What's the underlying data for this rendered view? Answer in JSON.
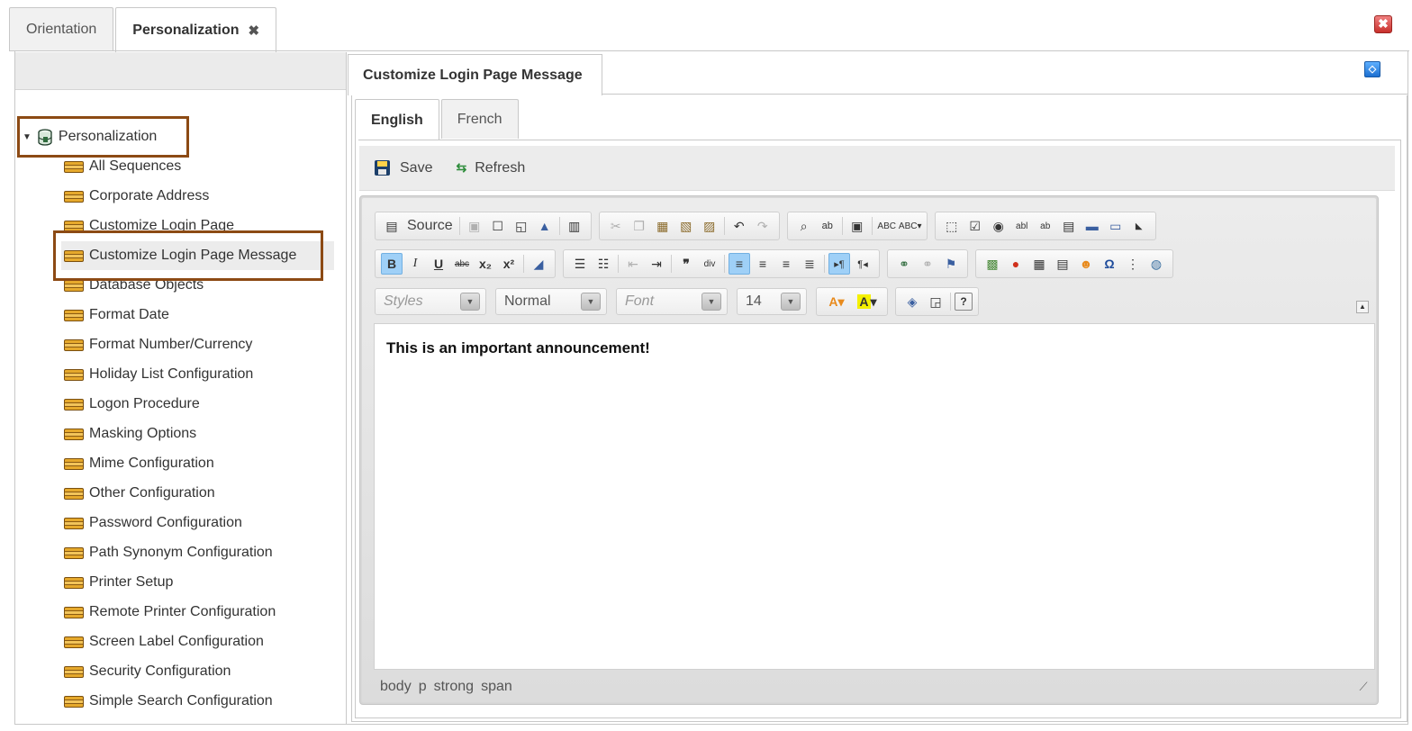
{
  "top_tabs": [
    {
      "label": "Orientation"
    },
    {
      "label": "Personalization",
      "close": "✖"
    }
  ],
  "window_close": "✖",
  "tree": {
    "root": "Personalization",
    "items": [
      "All Sequences",
      "Corporate Address",
      "Customize Login Page",
      "Customize Login Page Message",
      "Database Objects",
      "Format Date",
      "Format Number/Currency",
      "Holiday List Configuration",
      "Logon Procedure",
      "Masking Options",
      "Mime Configuration",
      "Other Configuration",
      "Password Configuration",
      "Path Synonym Configuration",
      "Printer Setup",
      "Remote Printer Configuration",
      "Screen Label Configuration",
      "Security Configuration",
      "Simple Search Configuration"
    ],
    "selected_index": 3
  },
  "panel": {
    "title": "Customize Login Page Message",
    "expand_glyph": "◇"
  },
  "lang_tabs": [
    {
      "label": "English"
    },
    {
      "label": "French"
    }
  ],
  "toolbar": {
    "save_label": "Save",
    "refresh_label": "Refresh"
  },
  "editor": {
    "source_label": "Source",
    "styles_placeholder": "Styles",
    "format_value": "Normal",
    "font_placeholder": "Font",
    "size_value": "14",
    "content": "This is an important announcement!",
    "path": [
      "body",
      "p",
      "strong",
      "span"
    ]
  },
  "colors": {
    "highlight_box": "#8c4a14",
    "active_button": "#9fd0f7",
    "node_icon": "#e6a92c"
  }
}
